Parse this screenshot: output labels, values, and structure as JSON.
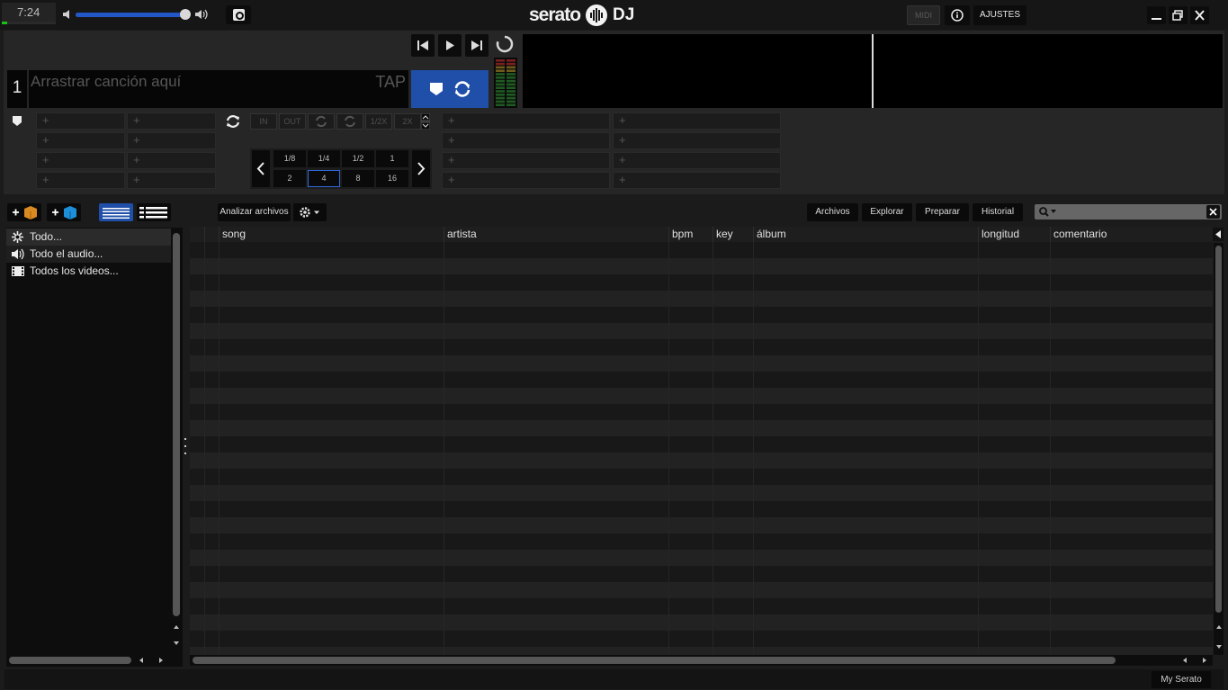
{
  "topbar": {
    "clock": "7:24",
    "cpu_level": 0.1,
    "volume_level": 0.96,
    "logo_wordmark": "serato",
    "logo_suffix": "DJ",
    "midi_label": "MIDI",
    "settings_label": "AJUSTES"
  },
  "deck": {
    "number": "1",
    "drop_placeholder": "Arrastrar canción aquí",
    "tap_label": "TAP",
    "loop_buttons": [
      "IN",
      "OUT",
      "1/2X",
      "2X"
    ],
    "beat_values": [
      "1/8",
      "1/4",
      "1/2",
      "1",
      "2",
      "4",
      "8",
      "16"
    ],
    "selected_beat": "4",
    "cue_slot_symbol": "+"
  },
  "library": {
    "analyze_label": "Analizar archivos",
    "tabs": [
      "Archivos",
      "Explorar",
      "Preparar",
      "Historial"
    ],
    "sidebar_items": [
      {
        "label": "Todo...",
        "icon": "asterisk-icon"
      },
      {
        "label": "Todo el audio...",
        "icon": "speaker-icon"
      },
      {
        "label": "Todos los videos...",
        "icon": "film-icon"
      }
    ],
    "columns": [
      "song",
      "artista",
      "bpm",
      "key",
      "álbum",
      "longitud",
      "comentario"
    ]
  },
  "status": {
    "my_serato_label": "My Serato"
  },
  "colors": {
    "accent": "#1f4fa8",
    "background": "#1b1b1b",
    "meter_green": "#19c319"
  }
}
